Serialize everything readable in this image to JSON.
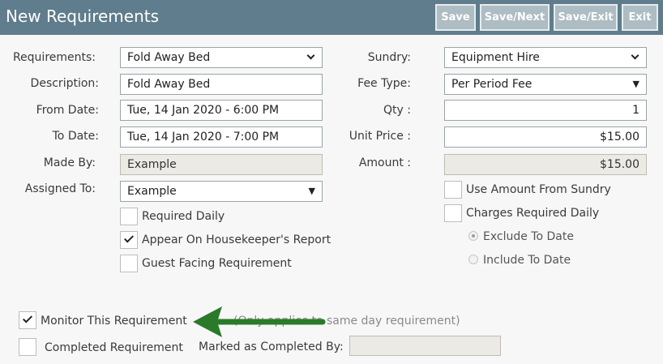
{
  "header": {
    "title": "New Requirements",
    "buttons": {
      "save": "Save",
      "save_next": "Save/Next",
      "save_exit": "Save/Exit",
      "exit": "Exit"
    }
  },
  "left": {
    "requirements": {
      "label": "Requirements:",
      "value": "Fold Away Bed"
    },
    "description": {
      "label": "Description:",
      "value": "Fold Away Bed"
    },
    "from_date": {
      "label": "From Date:",
      "value": "Tue, 14 Jan 2020 - 6:00 PM"
    },
    "to_date": {
      "label": "To Date:",
      "value": "Tue, 14 Jan 2020 - 7:00 PM"
    },
    "made_by": {
      "label": "Made By:",
      "value": "Example"
    },
    "assigned_to": {
      "label": "Assigned To:",
      "value": "Example"
    },
    "required_daily": {
      "label": "Required Daily",
      "checked": false
    },
    "housekeeper": {
      "label": "Appear On Housekeeper's Report",
      "checked": true
    },
    "guest_facing": {
      "label": "Guest Facing Requirement",
      "checked": false
    }
  },
  "right": {
    "sundry": {
      "label": "Sundry:",
      "value": "Equipment Hire"
    },
    "fee_type": {
      "label": "Fee Type:",
      "value": "Per Period Fee"
    },
    "qty": {
      "label": "Qty :",
      "value": "1"
    },
    "unit_price": {
      "label": "Unit Price :",
      "value": "$15.00"
    },
    "amount": {
      "label": "Amount :",
      "value": "$15.00"
    },
    "use_amount": {
      "label": "Use Amount From Sundry",
      "checked": false
    },
    "charges_daily": {
      "label": "Charges Required Daily",
      "checked": false
    },
    "exclude_to_date": {
      "label": "Exclude To Date",
      "selected": true
    },
    "include_to_date": {
      "label": "Include To Date",
      "selected": false
    }
  },
  "bottom": {
    "monitor": {
      "label": "Monitor This Requirement",
      "checked": true
    },
    "monitor_note": "(Only applies to same day requirement)",
    "completed": {
      "label": "Completed Requirement",
      "checked": false
    },
    "marked_completed_by": {
      "label": "Marked as Completed By:",
      "value": ""
    }
  },
  "annotation": {
    "arrow_color": "#2a7a2a"
  },
  "colors": {
    "header_bg": "#5f7d8c",
    "button_bg": "#aebcc3"
  },
  "icons": [
    "chevron-down-icon",
    "caret-down-icon",
    "checkmark-icon",
    "arrow-left-icon"
  ]
}
